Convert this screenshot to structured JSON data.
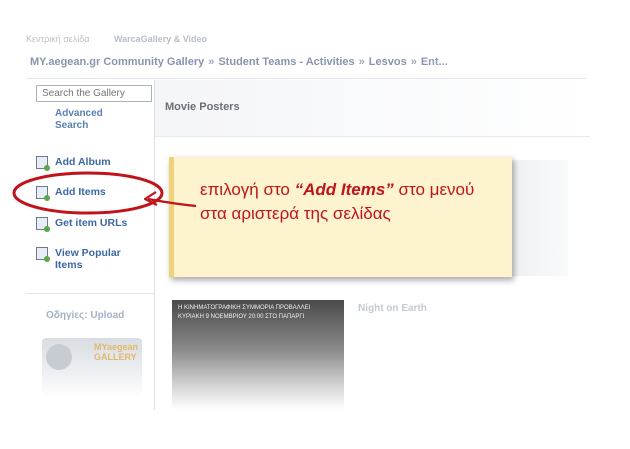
{
  "header": {
    "nav": [
      "Κεντρική σελίδα",
      "WarcaGallery & Video"
    ],
    "breadcrumb": [
      "MY.aegean.gr Community Gallery",
      "Student Teams - Activities",
      "Lesvos",
      "Ent..."
    ]
  },
  "sidebar": {
    "search_placeholder": "Search the Gallery",
    "advanced_search": "Advanced Search",
    "items": [
      {
        "label": "Add Album",
        "icon": "album-icon"
      },
      {
        "label": "Add Items",
        "icon": "add-items-icon"
      },
      {
        "label": "Get item URLs",
        "icon": "urls-icon"
      },
      {
        "label": "View Popular Items",
        "icon": "popular-icon"
      }
    ],
    "guide_title": "Οδηγίες: Upload",
    "guide_logo": "MYaegean GALLERY"
  },
  "main": {
    "title": "Movie Posters",
    "poster_lines": [
      "Η ΚΙΝΗΜΑΤΟΓΡΑΦΙΚΗ ΣΥΜΜΟΡΙΑ ΠΡΟΒΑΛΛΕΙ",
      "ΚΥΡΙΑΚΗ 9 ΝΟΕΜΒΡΙΟΥ 20:00 ΣΤΟ ΠΑΠΑΡΓΙ"
    ],
    "item_label": "Night on Earth"
  },
  "callout": {
    "before": "επιλογή στο ",
    "emphasis": "“Add Items”",
    "after": " στο μενού στα αριστερά της σελίδας"
  },
  "colors": {
    "annotation": "#c0141c",
    "callout_bg": "#fdf3ce",
    "link": "#3c67a6"
  }
}
